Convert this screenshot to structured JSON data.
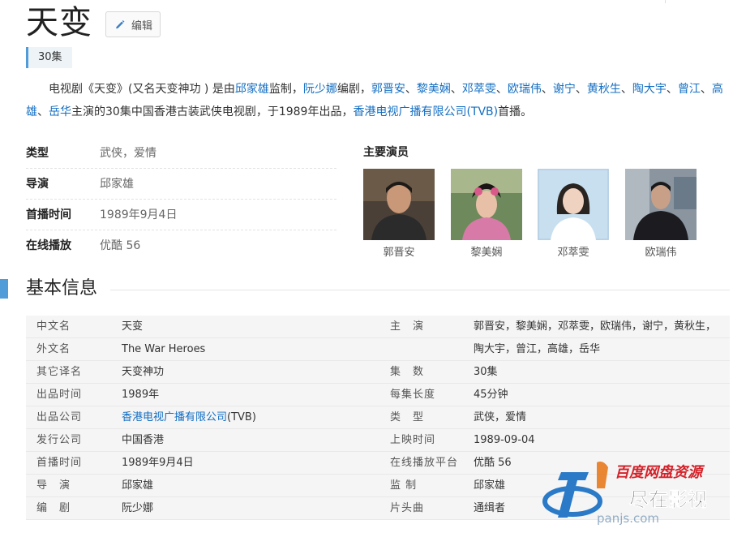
{
  "title": "天变",
  "edit_label": "编辑",
  "tag": "30集",
  "summary": [
    {
      "t": "电视剧《天变》(又名天变神功 ) 是由"
    },
    {
      "t": "邱家雄",
      "link": true
    },
    {
      "t": "监制，"
    },
    {
      "t": "阮少娜",
      "link": true
    },
    {
      "t": "编剧，"
    },
    {
      "t": "郭晋安",
      "link": true
    },
    {
      "t": "、"
    },
    {
      "t": "黎美娴",
      "link": true
    },
    {
      "t": "、"
    },
    {
      "t": "邓萃雯",
      "link": true
    },
    {
      "t": "、"
    },
    {
      "t": "欧瑞伟",
      "link": true
    },
    {
      "t": "、"
    },
    {
      "t": "谢宁",
      "link": true
    },
    {
      "t": "、"
    },
    {
      "t": "黄秋生",
      "link": true
    },
    {
      "t": "、"
    },
    {
      "t": "陶大宇",
      "link": true
    },
    {
      "t": "、"
    },
    {
      "t": "曾江",
      "link": true
    },
    {
      "t": "、"
    },
    {
      "t": "高雄",
      "link": true
    },
    {
      "t": "、"
    },
    {
      "t": "岳华",
      "link": true
    },
    {
      "t": "主演的30集中国香港古装武侠电视剧，于1989年出品，"
    },
    {
      "t": "香港电视广播有限公司(TVB)",
      "link": true
    },
    {
      "t": "首播。"
    }
  ],
  "info": [
    {
      "k": "类型",
      "v": "武侠，爱情",
      "link": false
    },
    {
      "k": "导演",
      "v": " 邱家雄",
      "link": true
    },
    {
      "k": "首播时间",
      "v": "1989年9月4日",
      "link": false
    },
    {
      "k": "在线播放",
      "v": "优酷 56",
      "link": true
    }
  ],
  "cast_title": "主要演员",
  "cast": [
    "郭晋安",
    "黎美娴",
    "邓萃雯",
    "欧瑞伟"
  ],
  "section_title": "基本信息",
  "basic": [
    {
      "l1": "中文名",
      "v1": "天变",
      "v1link": false,
      "l2": "主　演",
      "v2": "郭晋安，黎美娴，邓萃雯，欧瑞伟，谢宁，黄秋生，",
      "v2link": true
    },
    {
      "l1": "外文名",
      "v1": "The War Heroes",
      "v1link": false,
      "l2": "",
      "v2": "陶大宇，曾江，高雄，岳华",
      "v2link": true
    },
    {
      "l1": "其它译名",
      "v1": "天变神功",
      "v1link": false,
      "l2": "集　数",
      "v2": "30集",
      "v2link": false
    },
    {
      "l1": "出品时间",
      "v1": "1989年",
      "v1link": false,
      "l2": "每集长度",
      "v2": "45分钟",
      "v2link": false
    },
    {
      "l1": "出品公司",
      "v1": "香港电视广播有限公司",
      "v1suffix": "(TVB)",
      "v1link": true,
      "l2": "类　型",
      "v2": "武侠，爱情",
      "v2link": false
    },
    {
      "l1": "发行公司",
      "v1": "中国香港",
      "v1link": true,
      "l2": "上映时间",
      "v2": "1989-09-04",
      "v2link": false
    },
    {
      "l1": "首播时间",
      "v1": "1989年9月4日",
      "v1link": false,
      "l2": "在线播放平台",
      "v2": "优酷 56",
      "v2link": true
    },
    {
      "l1": "导　演",
      "v1": " 邱家雄",
      "v1link": true,
      "l2": "监 制",
      "v2": "邱家雄",
      "v2link": true
    },
    {
      "l1": "编　剧",
      "v1": "阮少娜",
      "v1link": true,
      "l2": "片头曲",
      "v2": "通缉者",
      "v2link": true
    }
  ],
  "watermark": {
    "line1": "百度网盘资源",
    "line2": "尽在影视",
    "site": "panjs.com"
  },
  "colors": {
    "link": "#136ec2",
    "accent": "#4f9cd8",
    "row_bg": "#f5f5f5"
  }
}
